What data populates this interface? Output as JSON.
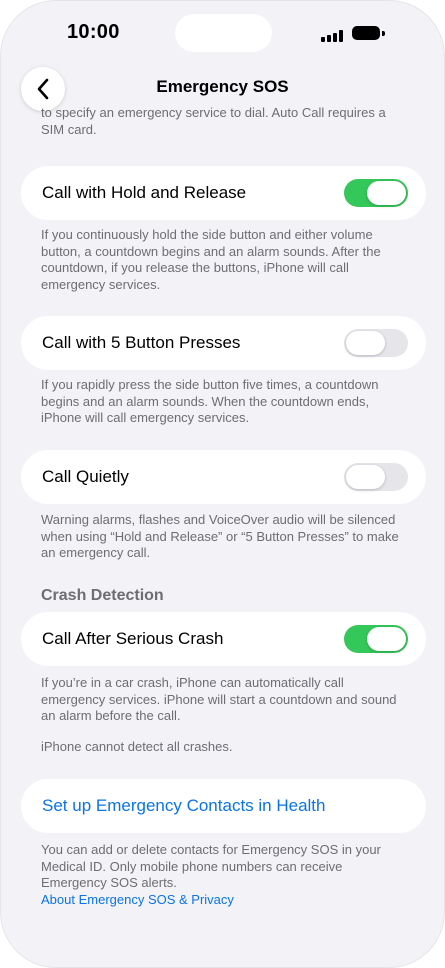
{
  "status": {
    "time": "10:00"
  },
  "nav": {
    "title": "Emergency SOS"
  },
  "top_footer": "to specify an emergency service to dial. Auto Call requires a SIM card.",
  "rows": [
    {
      "label": "Call with Hold and Release",
      "on": true,
      "footer": "If you continuously hold the side button and either volume button, a countdown begins and an alarm sounds. After the countdown, if you release the buttons, iPhone will call emergency services."
    },
    {
      "label": "Call with 5 Button Presses",
      "on": false,
      "footer": "If you rapidly press the side button five times, a countdown begins and an alarm sounds. When the countdown ends, iPhone will call emergency services."
    },
    {
      "label": "Call Quietly",
      "on": false,
      "footer": "Warning alarms, flashes and VoiceOver audio will be silenced when using “Hold and Release” or “5 Button Presses” to make an emergency call."
    }
  ],
  "crash": {
    "header": "Crash Detection",
    "label": "Call After Serious Crash",
    "on": true,
    "footer1": "If you’re in a car crash, iPhone can automatically call emergency services. iPhone will start a countdown and sound an alarm before the call.",
    "footer2": "iPhone cannot detect all crashes."
  },
  "contacts": {
    "link": "Set up Emergency Contacts in Health",
    "footer": "You can add or delete contacts for Emergency SOS in your Medical ID. Only mobile phone numbers can receive Emergency SOS alerts.",
    "about_link": "About Emergency SOS & Privacy"
  },
  "colors": {
    "accent": "#0a74e6",
    "toggle_on": "#34c759",
    "toggle_off": "#e5e5ea",
    "background": "#f2f2f7"
  }
}
